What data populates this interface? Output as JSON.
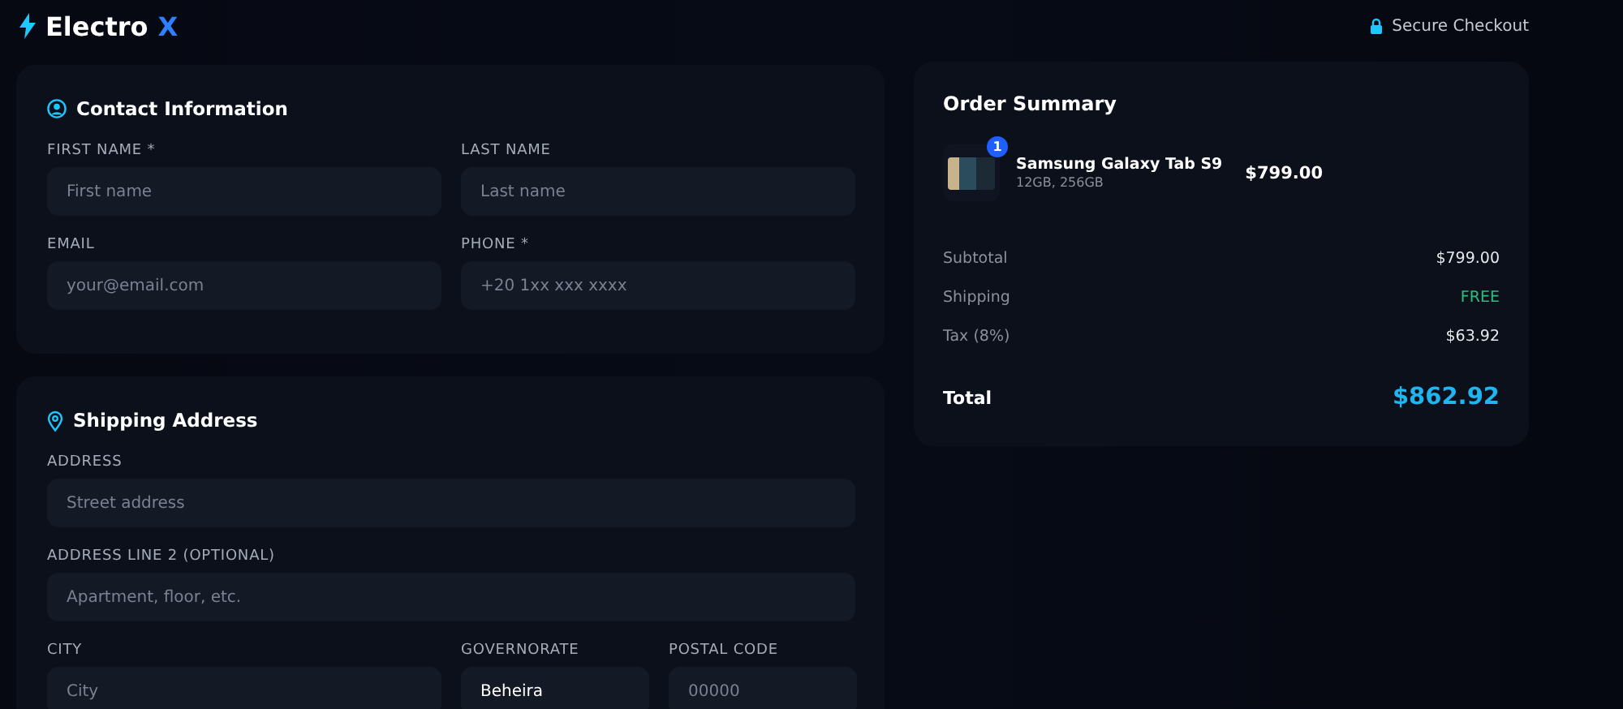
{
  "header": {
    "brand": "Electro",
    "brand_accent": "X",
    "secure": "Secure Checkout"
  },
  "sections": [
    {
      "title": "Contact Information",
      "kind": "contact",
      "rows": [
        [
          {
            "label": "FIRST NAME *",
            "placeholder": "First name"
          },
          {
            "label": "LAST NAME",
            "placeholder": "Last name"
          }
        ],
        [
          {
            "label": "EMAIL",
            "placeholder": "your@email.com"
          },
          {
            "label": "PHONE *",
            "placeholder": "+20 1xx xxx xxxx"
          }
        ]
      ]
    },
    {
      "title": "Shipping Address",
      "kind": "shipping",
      "rows": [
        [
          {
            "label": "ADDRESS",
            "placeholder": "Street address"
          }
        ],
        [
          {
            "label": "ADDRESS LINE 2 (OPTIONAL)",
            "placeholder": "Apartment, floor, etc."
          }
        ],
        [
          {
            "label": "CITY",
            "placeholder": "City"
          },
          {
            "label": "GOVERNORATE",
            "value": "Beheira"
          },
          {
            "label": "POSTAL CODE",
            "placeholder": "00000"
          }
        ]
      ]
    }
  ],
  "summary": {
    "title": "Order Summary",
    "items": [
      {
        "name": "Samsung Galaxy Tab S9",
        "variant": "12GB, 256GB",
        "price": "$799.00",
        "quantity": "1"
      }
    ],
    "lines": [
      {
        "label": "Subtotal",
        "value": "$799.00",
        "kind": "plain"
      },
      {
        "label": "Shipping",
        "value": "FREE",
        "kind": "free"
      },
      {
        "label": "Tax (8%)",
        "value": "$63.92",
        "kind": "plain"
      }
    ],
    "total": {
      "label": "Total",
      "value": "$862.92"
    }
  }
}
